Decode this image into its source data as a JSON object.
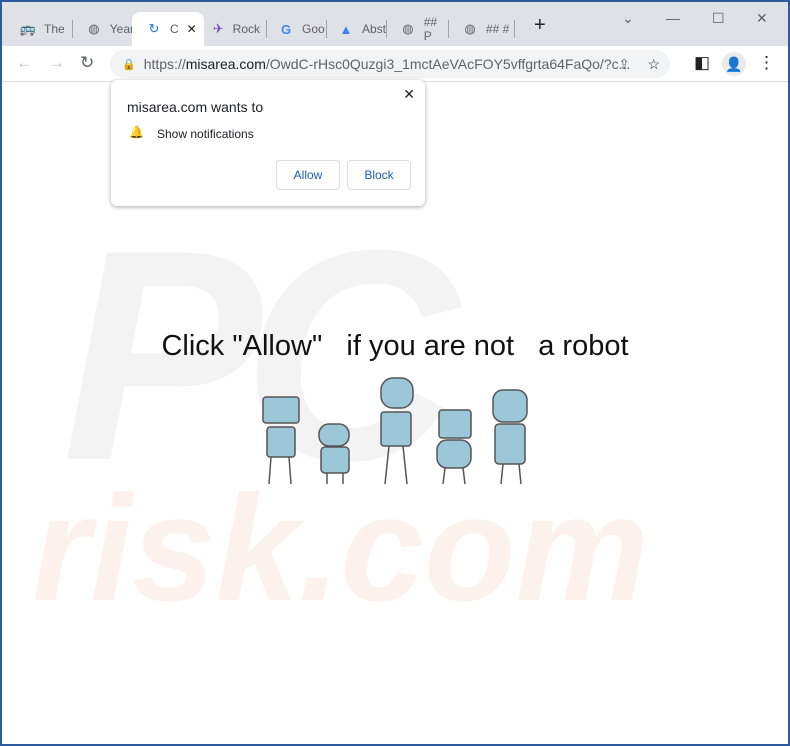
{
  "tabs": [
    {
      "title": "The",
      "icon": "bus-icon"
    },
    {
      "title": "Year",
      "icon": "globe-icon"
    },
    {
      "title": "C",
      "icon": "loading-icon",
      "active": true
    },
    {
      "title": "Rock",
      "icon": "rocket-icon"
    },
    {
      "title": "Goo",
      "icon": "google-icon"
    },
    {
      "title": "Abst",
      "icon": "arrow-logo-icon"
    },
    {
      "title": "## P",
      "icon": "globe-icon"
    },
    {
      "title": "## #",
      "icon": "globe-icon"
    }
  ],
  "address": {
    "prefix": "https://",
    "domain": "misarea.com",
    "path": "/OwdC-rHsc0Quzgi3_1mctAeVAcFOY5vffgrta64FaQo/?c..."
  },
  "popup": {
    "title": "misarea.com wants to",
    "permission": "Show notifications",
    "allow": "Allow",
    "block": "Block"
  },
  "page": {
    "headline": "Click \"Allow\"   if you are not   a robot"
  },
  "watermark": {
    "top": "PC",
    "bottom": "risk.com"
  },
  "colors": {
    "frame": "#2d5b9e",
    "accent": "#1a5fb4",
    "robot": "#9cc7d9"
  }
}
